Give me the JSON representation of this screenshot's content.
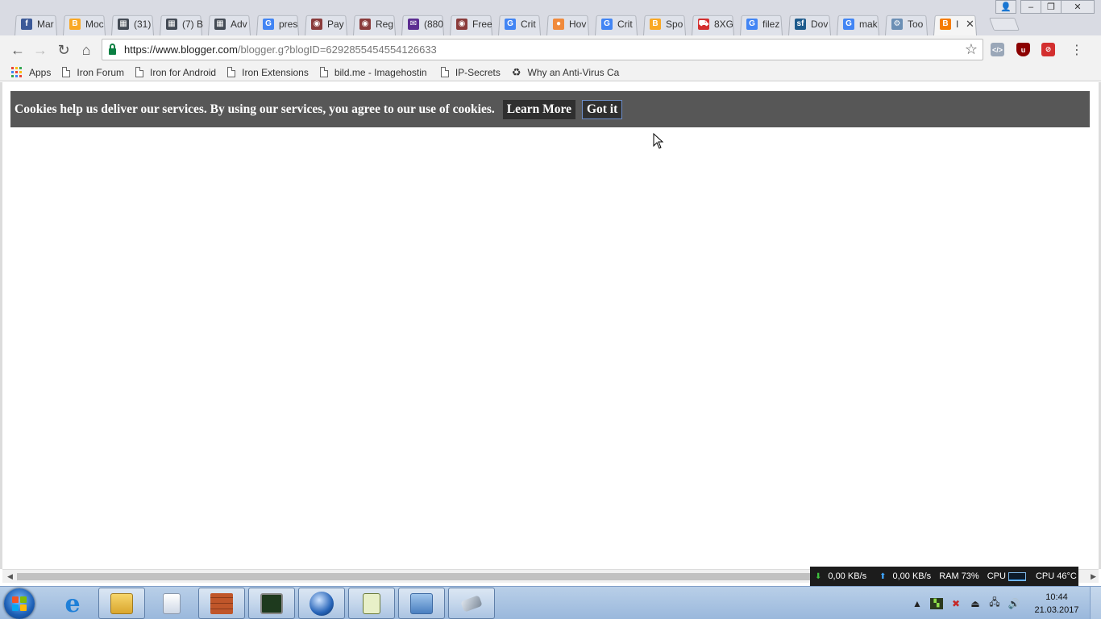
{
  "window": {
    "tabs": [
      {
        "title": "Mar",
        "icon": "facebook-icon",
        "color": "#3b5998",
        "glyph": "f"
      },
      {
        "title": "Moc",
        "icon": "blogger-icon",
        "color": "#f9a825",
        "glyph": "B"
      },
      {
        "title": "(31)",
        "icon": "chart-icon",
        "color": "#444b55",
        "glyph": "▦"
      },
      {
        "title": "(7) B",
        "icon": "chart-icon",
        "color": "#444b55",
        "glyph": "▦"
      },
      {
        "title": "Adv",
        "icon": "chart-icon",
        "color": "#444b55",
        "glyph": "▦"
      },
      {
        "title": "pres",
        "icon": "google-icon",
        "color": "#4285f4",
        "glyph": "G"
      },
      {
        "title": "Pay",
        "icon": "globe-icon",
        "color": "#8a3b3b",
        "glyph": "◉"
      },
      {
        "title": "Reg",
        "icon": "globe-icon",
        "color": "#8a3b3b",
        "glyph": "◉"
      },
      {
        "title": "(880",
        "icon": "mail-icon",
        "color": "#5c2d91",
        "glyph": "✉"
      },
      {
        "title": "Free",
        "icon": "globe-icon",
        "color": "#8a3b3b",
        "glyph": "◉"
      },
      {
        "title": "Crit",
        "icon": "google-icon",
        "color": "#4285f4",
        "glyph": "G"
      },
      {
        "title": "Hov",
        "icon": "circle-icon",
        "color": "#f08a3c",
        "glyph": "●"
      },
      {
        "title": "Crit",
        "icon": "google-icon",
        "color": "#4285f4",
        "glyph": "G"
      },
      {
        "title": "Spo",
        "icon": "blogger-icon",
        "color": "#f9a825",
        "glyph": "B"
      },
      {
        "title": "8XG",
        "icon": "cart-icon",
        "color": "#d32f2f",
        "glyph": "⛟"
      },
      {
        "title": "filez",
        "icon": "google-icon",
        "color": "#4285f4",
        "glyph": "G"
      },
      {
        "title": "Dov",
        "icon": "sourceforge-icon",
        "color": "#1d5a8c",
        "glyph": "sf"
      },
      {
        "title": "mak",
        "icon": "google-icon",
        "color": "#4285f4",
        "glyph": "G"
      },
      {
        "title": "Too",
        "icon": "tool-icon",
        "color": "#6b8fb5",
        "glyph": "⚙"
      },
      {
        "title": "I",
        "icon": "blogger-icon",
        "color": "#f57c00",
        "glyph": "B",
        "active": true
      }
    ]
  },
  "toolbar": {
    "url_host": "https://www.blogger.com",
    "url_path": "/blogger.g?blogID=6292855454554126633"
  },
  "bookmarks": {
    "apps": "Apps",
    "items": [
      "Iron Forum",
      "Iron for Android",
      "Iron Extensions",
      "bild.me - Imagehostin",
      "IP-Secrets"
    ],
    "last": "Why an Anti-Virus Car"
  },
  "cookie_bar": {
    "message": "Cookies help us deliver our services. By using our services, you agree to our use of cookies.",
    "learn_more": "Learn More",
    "got_it": "Got it"
  },
  "netmeter": {
    "down": "0,00 KB/s",
    "up": "0,00 KB/s",
    "ram": "RAM 73%",
    "cpu_label": "CPU",
    "cpu_temp": "CPU 46°C"
  },
  "taskbar": {
    "time": "10:44",
    "date": "21.03.2017"
  },
  "colors": {
    "cookie_bar_bg": "#575757",
    "cookie_btn_bg": "#2f2f2f",
    "secure_green": "#0b8043"
  }
}
